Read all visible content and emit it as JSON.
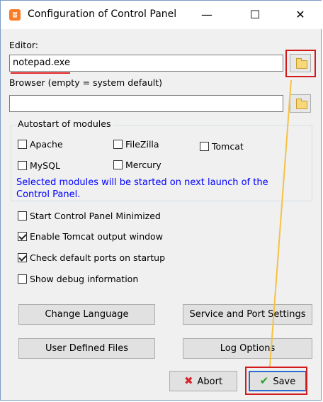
{
  "window": {
    "title": "Configuration of Control Panel",
    "minimize": "—",
    "maximize": "☐",
    "close": "✕",
    "icon_glyph": "ʬ"
  },
  "editor": {
    "label": "Editor:",
    "value": "notepad.exe"
  },
  "browser": {
    "label": "Browser (empty = system default)",
    "value": ""
  },
  "autostart": {
    "title": "Autostart of modules",
    "modules": [
      {
        "label": "Apache",
        "checked": false
      },
      {
        "label": "FileZilla",
        "checked": false
      },
      {
        "label": "Tomcat",
        "checked": false
      },
      {
        "label": "MySQL",
        "checked": false
      },
      {
        "label": "Mercury",
        "checked": false
      }
    ],
    "note": "Selected modules will be started on next launch of the Control Panel."
  },
  "options": [
    {
      "label": "Start Control Panel Minimized",
      "checked": false
    },
    {
      "label": "Enable Tomcat output window",
      "checked": true
    },
    {
      "label": "Check default ports on startup",
      "checked": true
    },
    {
      "label": "Show debug information",
      "checked": false
    }
  ],
  "buttons": {
    "change_language": "Change Language",
    "service_port": "Service and Port Settings",
    "user_defined": "User Defined Files",
    "log_options": "Log Options",
    "abort": "Abort",
    "save": "Save"
  },
  "colors": {
    "accent_red": "#d21a1a",
    "arrow_yellow": "#f5c242",
    "note_blue": "#0000ff"
  }
}
